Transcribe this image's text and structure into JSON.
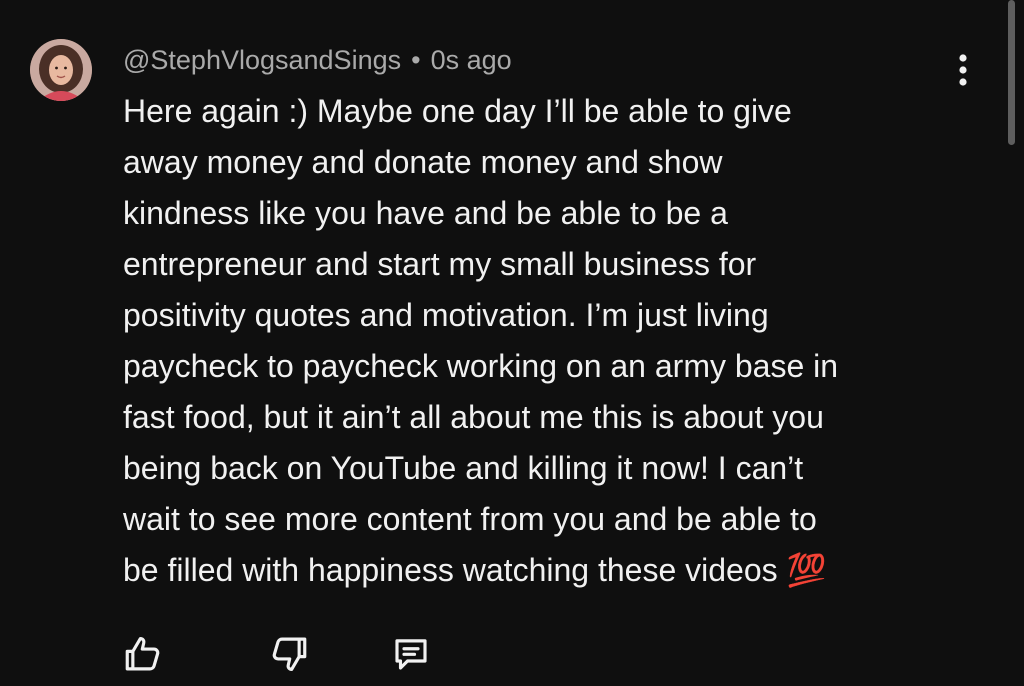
{
  "comment": {
    "author": "@StephVlogsandSings",
    "separator": "•",
    "timestamp": "0s ago",
    "lines": [
      "Here again :) Maybe one day I’ll be able to give",
      "away money and donate money and show",
      "kindness like you have and be able to be a",
      "entrepreneur and start my small business for",
      "positivity quotes and motivation. I’m just living",
      "paycheck to paycheck working on an army base in",
      "fast food, but it ain’t all about me this is about you",
      "being back on YouTube and killing it now! I can’t",
      "wait to see more content from you and be able to",
      "be filled with happiness watching these videos 💯"
    ]
  },
  "icons": {
    "avatar": "user-avatar",
    "more": "three-dot-vertical-icon",
    "like": "thumbs-up-icon",
    "dislike": "thumbs-down-icon",
    "reply": "reply-comment-icon"
  },
  "colors": {
    "background": "#0f0f0f",
    "text_primary": "#f1f1f1",
    "text_secondary": "#aaaaaa"
  }
}
